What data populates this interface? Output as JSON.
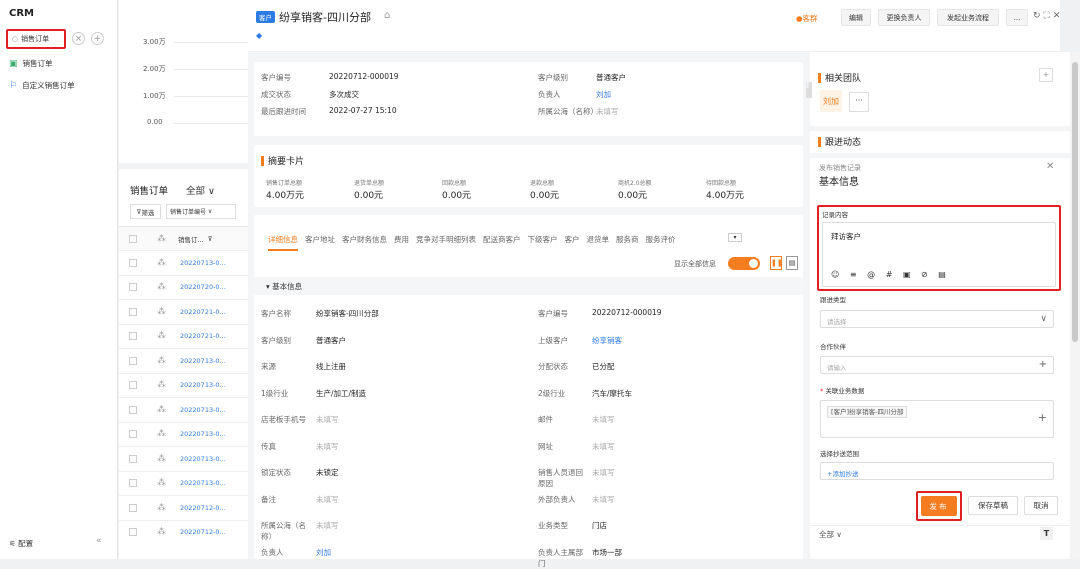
{
  "sidebar": {
    "brand": "CRM",
    "search_value": "销售订单",
    "items": [
      {
        "label": "销售订单"
      },
      {
        "label": "自定义销售订单"
      }
    ],
    "config_label": "配置",
    "collapse": "«"
  },
  "list": {
    "axis": [
      "3.00万",
      "2.00万",
      "1.00万",
      "0.00"
    ],
    "title": "销售订单",
    "scope": "全部",
    "filter": "筛选",
    "field": "销售订单编号",
    "col": "销售订...",
    "rows": [
      "20220713-0...",
      "20220720-0...",
      "20220721-0...",
      "20220721-0...",
      "20220713-0...",
      "20220713-0...",
      "20220713-0...",
      "20220713-0...",
      "20220713-0...",
      "20220713-0...",
      "20220712-0...",
      "20220712-0..."
    ]
  },
  "detail": {
    "tag": "客户",
    "title": "纷享销客-四川分部",
    "buttons": {
      "hot": "●客群",
      "edit": "编辑",
      "change": "更换负责人",
      "flow": "发起业务流程",
      "more": "..."
    },
    "info": [
      {
        "l": "客户编号",
        "v": "20220712-000019"
      },
      {
        "l": "客户级别",
        "v": "普通客户"
      },
      {
        "l": "成交状态",
        "v": "多次成交"
      },
      {
        "l": "负责人",
        "v": "刘加"
      },
      {
        "l": "最后跟进时间",
        "v": "2022-07-27 15:10"
      },
      {
        "l": "所属公海（名称）",
        "v": "未填写"
      }
    ],
    "summary": {
      "title": "摘要卡片",
      "items": [
        {
          "l": "销售订单总额",
          "v": "4.00万元"
        },
        {
          "l": "退货单总额",
          "v": "0.00元"
        },
        {
          "l": "回款总额",
          "v": "0.00元"
        },
        {
          "l": "退款总额",
          "v": "0.00元"
        },
        {
          "l": "商机2.0总额",
          "v": "0.00元"
        },
        {
          "l": "待回款总额",
          "v": "4.00万元"
        }
      ]
    },
    "tabs": [
      "详细信息",
      "客户地址",
      "客户财务信息",
      "费用",
      "竞争对手明细列表",
      "配送商客户",
      "下级客户",
      "客户",
      "退货单",
      "服务商",
      "服务评价"
    ],
    "show_all": "显示全部信息",
    "basic": "基本信息",
    "fields": [
      {
        "l": "客户名称",
        "v": "纷享销客-四川分部",
        "l2": "客户编号",
        "v2": "20220712-000019"
      },
      {
        "l": "客户级别",
        "v": "普通客户",
        "l2": "上级客户",
        "v2": "纷享销客"
      },
      {
        "l": "来源",
        "v": "线上注册",
        "l2": "分配状态",
        "v2": "已分配"
      },
      {
        "l": "1级行业",
        "v": "生产/加工/制造",
        "l2": "2级行业",
        "v2": "汽车/摩托车"
      },
      {
        "l": "店老板手机号",
        "v": "未填写",
        "l2": "邮件",
        "v2": "未填写"
      },
      {
        "l": "传真",
        "v": "未填写",
        "l2": "网址",
        "v2": "未填写"
      },
      {
        "l": "锁定状态",
        "v": "未锁定",
        "l2": "销售人员退回原因",
        "v2": "未填写"
      },
      {
        "l": "备注",
        "v": "未填写",
        "l2": "外部负责人",
        "v2": "未填写"
      },
      {
        "l": "所属公海（名称）",
        "v": "未填写",
        "l2": "业务类型",
        "v2": "门店"
      },
      {
        "l": "负责人",
        "v": "刘加",
        "l2": "负责人主属部门",
        "v2": "市场一部"
      }
    ]
  },
  "right": {
    "team": "相关团队",
    "member": "刘加",
    "more": "···",
    "follow": "跟进动态",
    "publish": "发布销售记录",
    "basic": "基本信息",
    "record_label": "记录内容",
    "record_value": "拜访客户",
    "tools": [
      "☺",
      "≡",
      "@",
      "#",
      "▣",
      "⊘",
      "▤"
    ],
    "type_label": "跟进类型",
    "type_ph": "请选择",
    "partner_label": "合作伙伴",
    "partner_ph": "请输入",
    "related_label": "关联业务数据",
    "related_value": "[客户]纷享销客-四川分部",
    "cc_label": "选择抄送范围",
    "cc_add": "+添加抄送",
    "publish_btn": "发布",
    "draft_btn": "保存草稿",
    "cancel_btn": "取消",
    "all": "全部"
  }
}
